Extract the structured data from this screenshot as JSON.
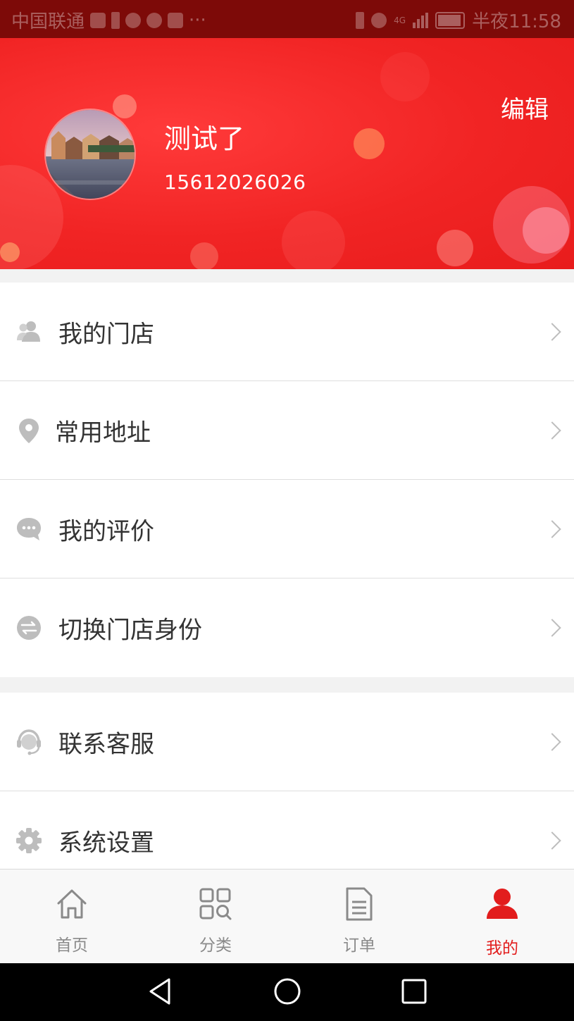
{
  "status_bar": {
    "carrier": "中国联通",
    "more": "···",
    "network": "4G",
    "time": "半夜11:58"
  },
  "profile": {
    "name": "测试了",
    "phone": "15612026026",
    "edit_label": "编辑"
  },
  "menu_groups": [
    [
      {
        "label": "我的门店",
        "icon": "people-icon"
      },
      {
        "label": "常用地址",
        "icon": "location-pin-icon"
      },
      {
        "label": "我的评价",
        "icon": "chat-bubble-icon"
      },
      {
        "label": "切换门店身份",
        "icon": "switch-icon"
      }
    ],
    [
      {
        "label": "联系客服",
        "icon": "customer-service-icon"
      },
      {
        "label": "系统设置",
        "icon": "gear-icon"
      }
    ]
  ],
  "tabbar": {
    "items": [
      {
        "label": "首页",
        "icon": "home-icon",
        "active": false
      },
      {
        "label": "分类",
        "icon": "category-grid-icon",
        "active": false
      },
      {
        "label": "订单",
        "icon": "order-document-icon",
        "active": false
      },
      {
        "label": "我的",
        "icon": "user-icon",
        "active": true
      }
    ]
  },
  "colors": {
    "brand_red": "#f12424",
    "active_tab": "#e21d1d",
    "status_bar": "#7d0a08"
  }
}
